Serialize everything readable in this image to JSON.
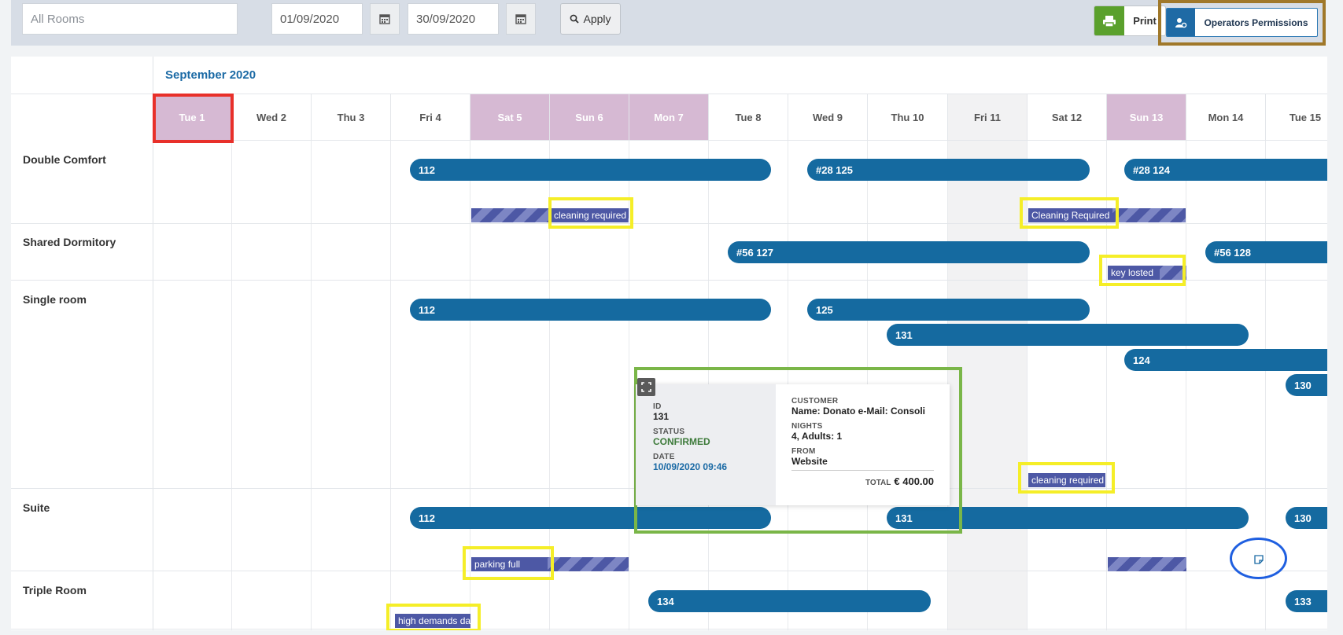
{
  "toolbar": {
    "rooms_placeholder": "All Rooms",
    "date_from": "01/09/2020",
    "date_to": "30/09/2020",
    "apply_label": "Apply",
    "print_label": "Print",
    "permissions_label": "Operators Permissions"
  },
  "calendar": {
    "month": "September 2020",
    "days": [
      "Tue 1",
      "Wed 2",
      "Thu 3",
      "Fri 4",
      "Sat 5",
      "Sun 6",
      "Mon 7",
      "Tue 8",
      "Wed 9",
      "Thu 10",
      "Fri 11",
      "Sat 12",
      "Sun 13",
      "Mon 14",
      "Tue 15"
    ],
    "rooms": [
      "Double Comfort",
      "Shared Dormitory",
      "Single room",
      "Suite",
      "Triple Room"
    ],
    "bookings": {
      "dc1": "112",
      "dc2": "#28 125",
      "dc3": "#28 124",
      "sd1": "#56 127",
      "sd2": "#56 128",
      "sr1": "112",
      "sr2": "125",
      "sr3": "131",
      "sr4": "124",
      "sr5": "130",
      "su1": "112",
      "su2": "131",
      "su3": "130",
      "tr1": "134",
      "tr2": "133"
    },
    "notes": {
      "dc_a": "cleaning required",
      "dc_b": "Cleaning Required",
      "sd_a": "key losted",
      "sr_a": "cleaning required",
      "su_a": "parking full",
      "tr_a": "high demands da"
    }
  },
  "popup": {
    "id_label": "ID",
    "id_value": "131",
    "status_label": "STATUS",
    "status_value": "CONFIRMED",
    "date_label": "DATE",
    "date_value": "10/09/2020 09:46",
    "customer_label": "CUSTOMER",
    "customer_value": "Name: Donato e-Mail: Consoli",
    "nights_label": "NIGHTS",
    "nights_value": "4, Adults: 1",
    "from_label": "FROM",
    "from_value": "Website",
    "total_label": "TOTAL",
    "total_value": "€ 400.00"
  },
  "colors": {
    "booking": "#156aa0",
    "weekend": "#d6b9d3",
    "print": "#5aa02c",
    "confirmed": "#3d7a3a"
  }
}
